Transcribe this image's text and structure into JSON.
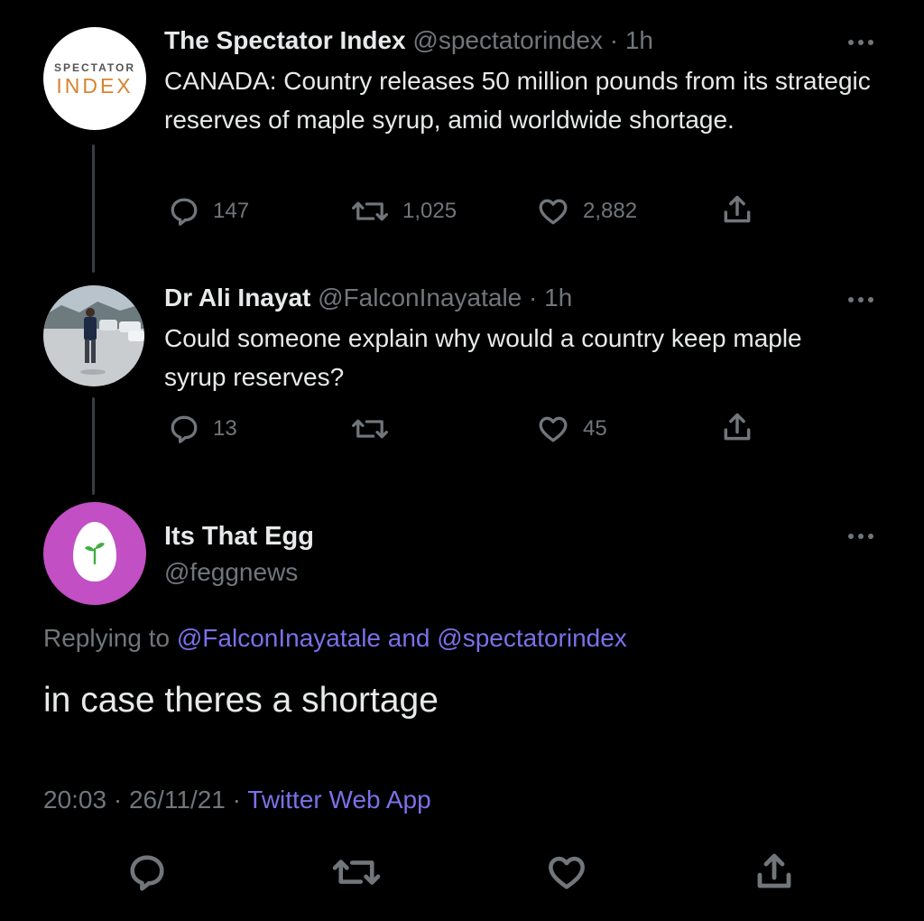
{
  "tweets": [
    {
      "author": "The Spectator Index",
      "handle": "@spectatorindex",
      "separator": "·",
      "time": "1h",
      "text": "CANADA: Country releases 50 million pounds from its strategic reserves of maple syrup, amid worldwide shortage.",
      "avatar": {
        "top_text": "SPECTATOR",
        "bottom_text": "INDEX"
      },
      "replies": "147",
      "retweets": "1,025",
      "likes": "2,882"
    },
    {
      "author": "Dr Ali Inayat",
      "handle": "@FalconInayatale",
      "separator": "·",
      "time": "1h",
      "text": "Could someone explain why would a country keep maple syrup reserves?",
      "replies": "13",
      "retweets": "",
      "likes": "45"
    }
  ],
  "main_tweet": {
    "author": "Its That Egg",
    "handle": "@feggnews",
    "replying_prefix": "Replying to",
    "replying_user1": "@FalconInayatale",
    "replying_and": "and",
    "replying_user2": "@spectatorindex",
    "text": "in case theres a shortage",
    "time": "20:03",
    "dot": "·",
    "date": "26/11/21",
    "source": "Twitter Web App",
    "avatar_color": "#c24fc3"
  },
  "colors": {
    "background": "#000000",
    "text": "#e7e9ea",
    "muted": "#71767b",
    "link": "#7d6fe8",
    "spectator_orange": "#d9832e"
  },
  "icons": [
    "reply-icon",
    "retweet-icon",
    "like-icon",
    "share-icon",
    "more-icon",
    "sprout-icon"
  ]
}
